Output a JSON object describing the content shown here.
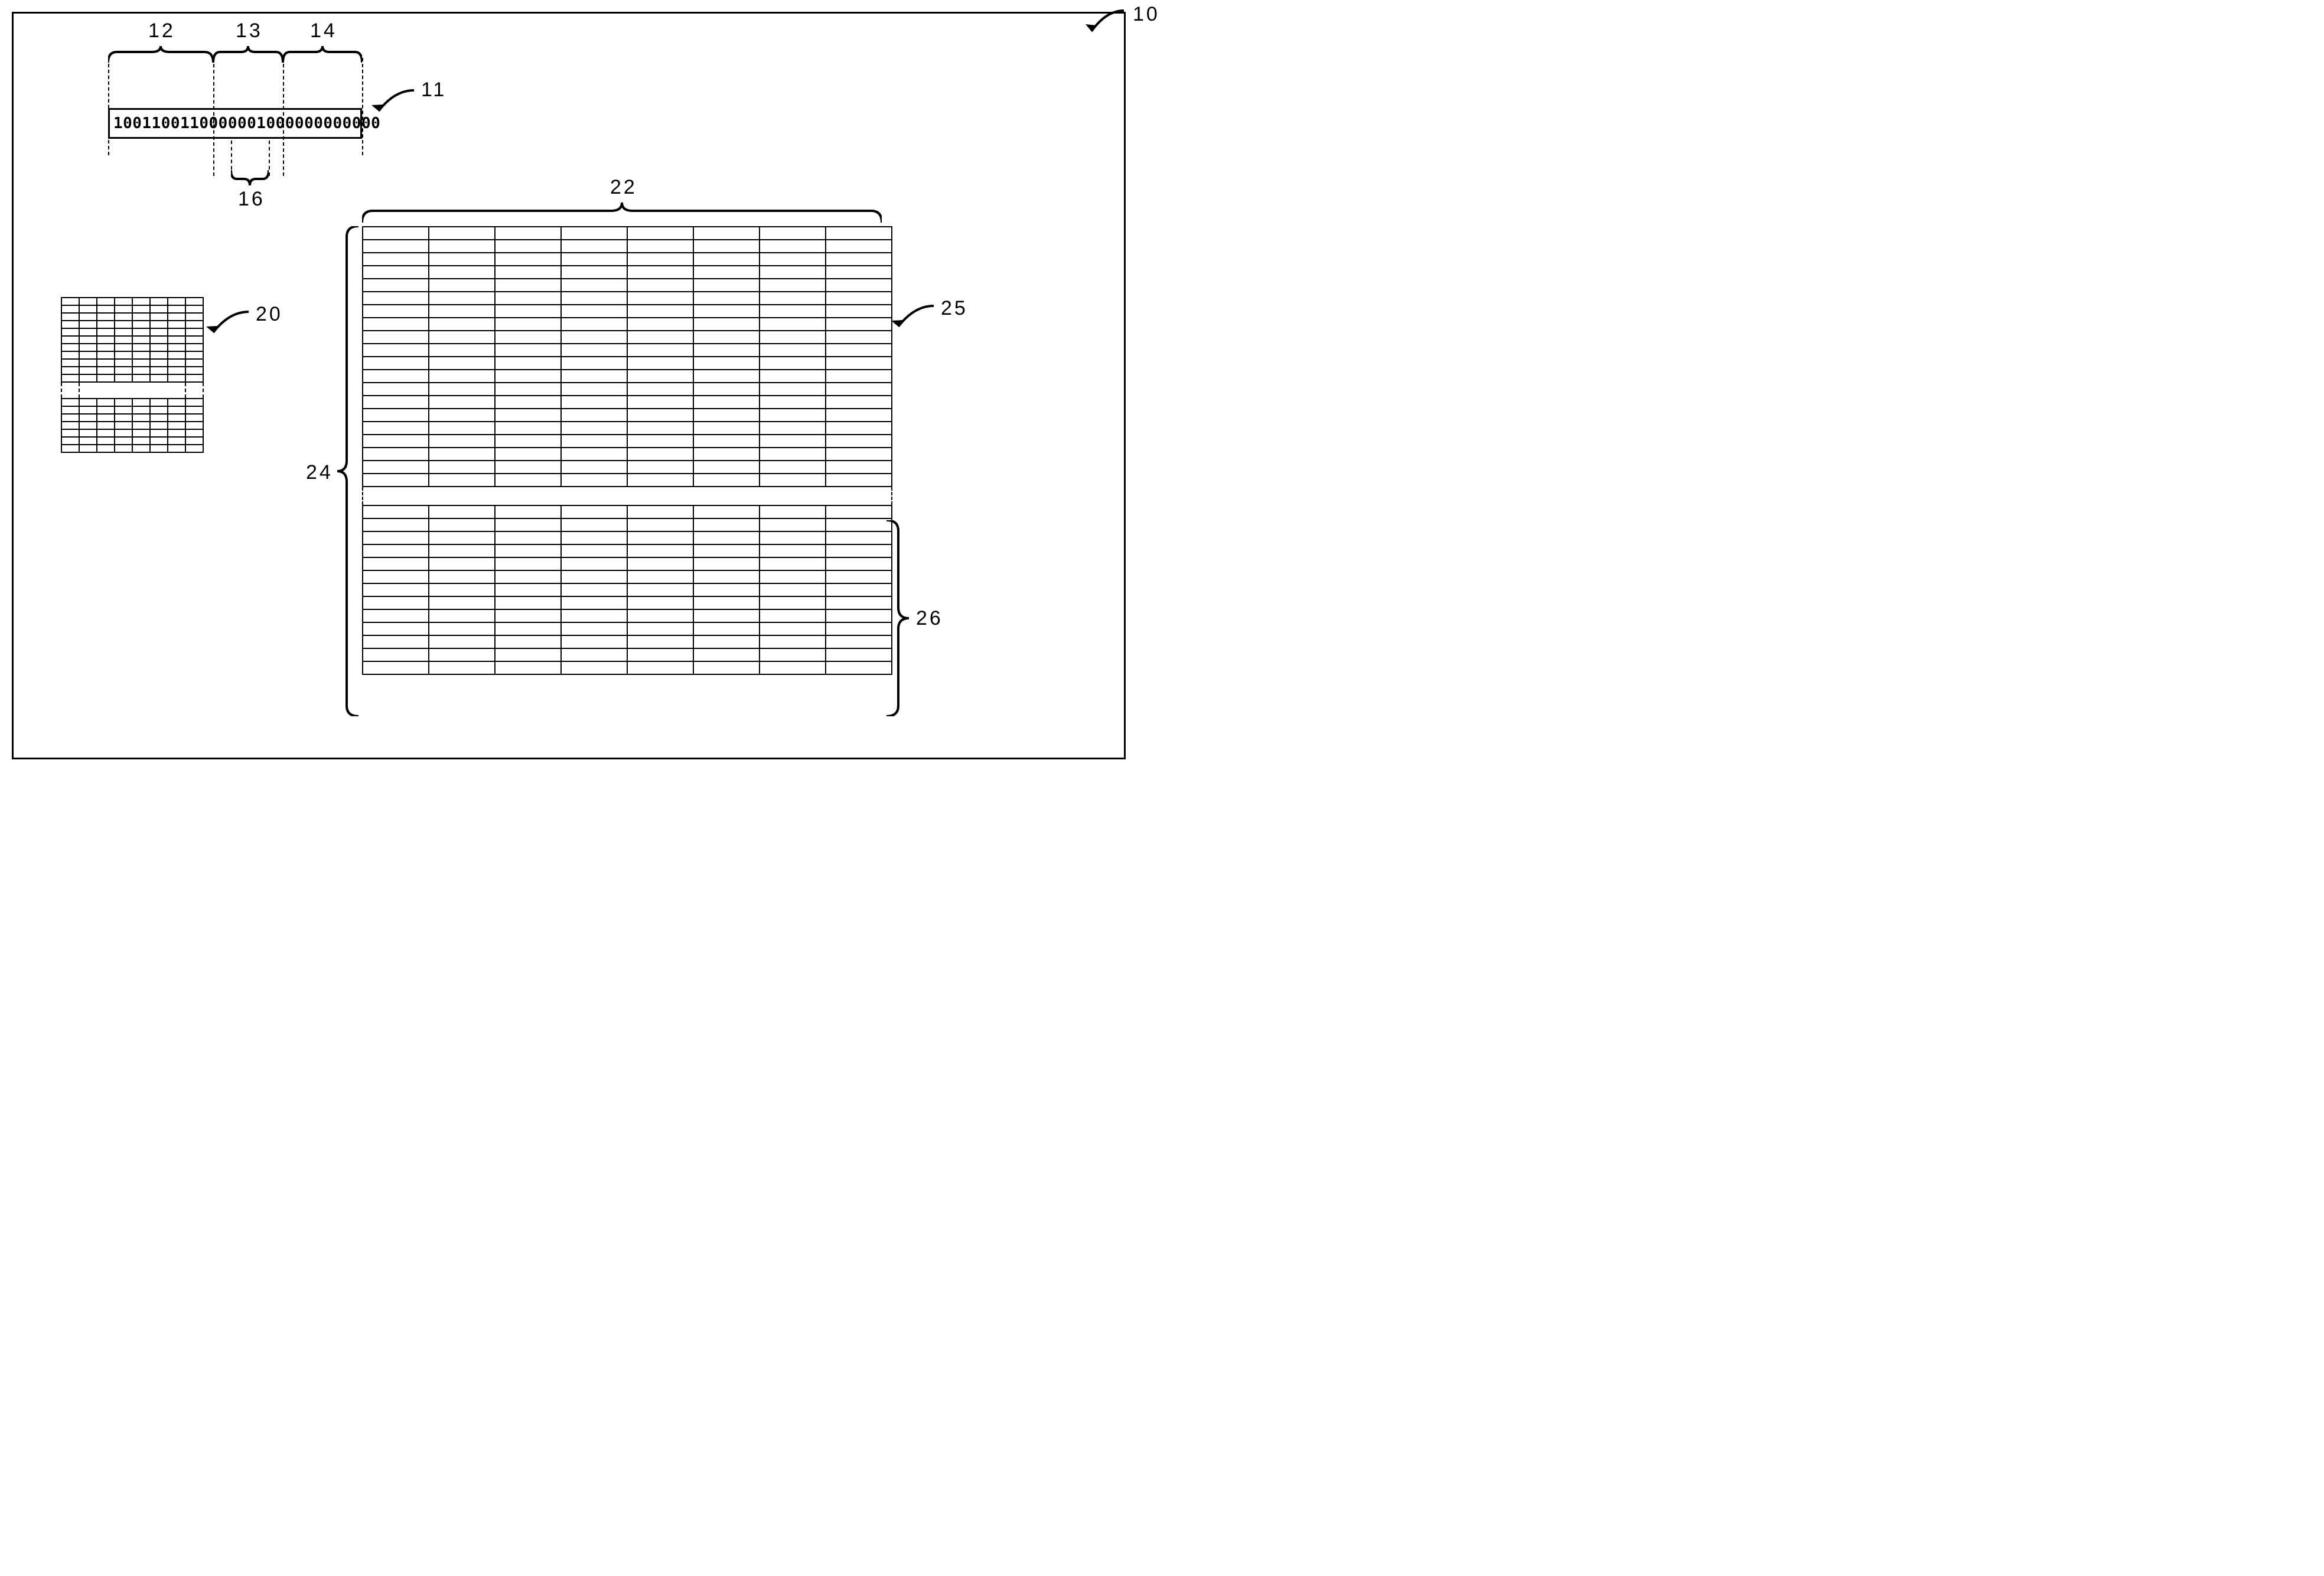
{
  "labels": {
    "l10": "10",
    "l11": "11",
    "l12": "12",
    "l13": "13",
    "l14": "14",
    "l16": "16",
    "l20": "20",
    "l22": "22",
    "l24": "24",
    "l25": "25",
    "l26": "26"
  },
  "register": {
    "bits": "1001100110000001000000000000"
  },
  "small_grid": {
    "cols": 8,
    "top_rows": 11,
    "bottom_rows": 7
  },
  "large_grid": {
    "cols": 8,
    "top_rows": 20,
    "bottom_rows": 13
  }
}
